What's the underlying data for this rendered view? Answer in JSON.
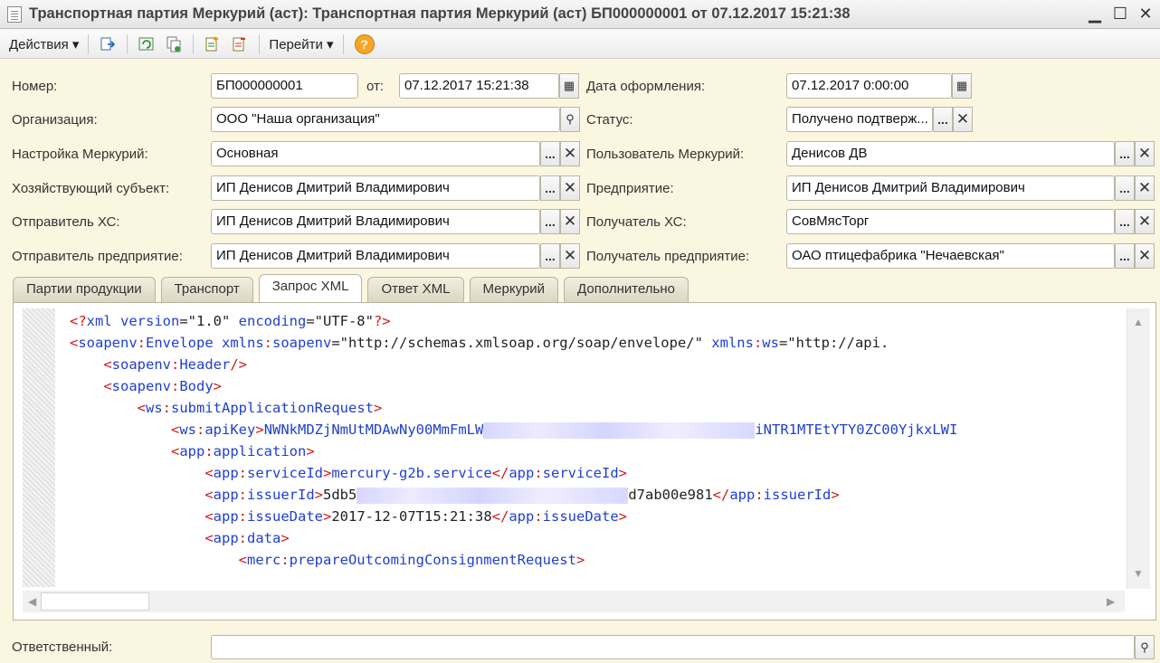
{
  "window": {
    "title": "Транспортная партия Меркурий (аст): Транспортная партия Меркурий (аст) БП000000001 от 07.12.2017 15:21:38",
    "minimize": "▁",
    "maximize": "☐",
    "close": "✕"
  },
  "toolbar": {
    "actions_label": "Действия ▾",
    "goto_label": "Перейти ▾",
    "help_label": "?"
  },
  "form": {
    "number_label": "Номер:",
    "number_value": "БП000000001",
    "from_label": "от:",
    "from_value": "07.12.2017 15:21:38",
    "issue_date_label": "Дата оформления:",
    "issue_date_value": "07.12.2017  0:00:00",
    "org_label": "Организация:",
    "org_value": "ООО \"Наша организация\"",
    "status_label": "Статус:",
    "status_value": "Получено подтверж...",
    "mercury_settings_label": "Настройка Меркурий:",
    "mercury_settings_value": "Основная",
    "mercury_user_label": "Пользователь Меркурий:",
    "mercury_user_value": "Денисов ДВ",
    "business_entity_label": "Хозяйствующий субъект:",
    "business_entity_value": "ИП Денисов Дмитрий Владимирович",
    "enterprise_label": "Предприятие:",
    "enterprise_value": "ИП Денисов Дмитрий Владимирович",
    "sender_hs_label": "Отправитель ХС:",
    "sender_hs_value": "ИП Денисов Дмитрий Владимирович",
    "receiver_hs_label": "Получатель ХС:",
    "receiver_hs_value": "СовМясТорг",
    "sender_ent_label": "Отправитель предприятие:",
    "sender_ent_value": "ИП Денисов Дмитрий Владимирович",
    "receiver_ent_label": "Получатель предприятие:",
    "receiver_ent_value": "ОАО птицефабрика \"Нечаевская\"",
    "responsible_label": "Ответственный:",
    "responsible_value": ""
  },
  "tabs": [
    {
      "label": "Партии продукции"
    },
    {
      "label": "Транспорт"
    },
    {
      "label": "Запрос XML"
    },
    {
      "label": "Ответ XML"
    },
    {
      "label": "Меркурий"
    },
    {
      "label": "Дополнительно"
    }
  ],
  "xml": {
    "l1_a": "<?",
    "l1_b": "xml version",
    "l1_c": "=\"1.0\" ",
    "l1_d": "encoding",
    "l1_e": "=\"UTF-8\"",
    "l1_f": "?>",
    "l2_a": "<",
    "l2_b": "soapenv",
    "l2_c": ":",
    "l2_d": "Envelope",
    "l2_e": " xmlns",
    "l2_f": ":",
    "l2_g": "soapenv",
    "l2_h": "=\"http://schemas.xmlsoap.org/soap/envelope/\" ",
    "l2_i": "xmlns",
    "l2_j": ":",
    "l2_k": "ws",
    "l2_l": "=\"http://api.",
    "l3_a": "<",
    "l3_b": "soapenv",
    "l3_c": ":",
    "l3_d": "Header",
    "l3_e": "/>",
    "l4_a": "<",
    "l4_b": "soapenv",
    "l4_c": ":",
    "l4_d": "Body",
    "l4_e": ">",
    "l5_a": "<",
    "l5_b": "ws",
    "l5_c": ":",
    "l5_d": "submitApplicationRequest",
    "l5_e": ">",
    "l6_a": "<",
    "l6_b": "ws",
    "l6_c": ":",
    "l6_d": "apiKey",
    "l6_e": ">",
    "l6_f": "NWNkMDZjNmUtMDAwNy00MmFmLW",
    "l6_g": "iNTR1MTEtYTY0ZC00YjkxLWI",
    "l7_a": "<",
    "l7_b": "app",
    "l7_c": ":",
    "l7_d": "application",
    "l7_e": ">",
    "l8_a": "<",
    "l8_b": "app",
    "l8_c": ":",
    "l8_d": "serviceId",
    "l8_e": ">",
    "l8_f": "mercury-g2b.service",
    "l8_g": "</",
    "l8_h": "app",
    "l8_i": ":",
    "l8_j": "serviceId",
    "l8_k": ">",
    "l9_a": "<",
    "l9_b": "app",
    "l9_c": ":",
    "l9_d": "issuerId",
    "l9_e": ">",
    "l9_f": "5db5",
    "l9_g": "d7ab00e981",
    "l9_h": "</",
    "l9_i": "app",
    "l9_j": ":",
    "l9_k": "issuerId",
    "l9_l": ">",
    "l10_a": "<",
    "l10_b": "app",
    "l10_c": ":",
    "l10_d": "issueDate",
    "l10_e": ">",
    "l10_f": "2017-12-07T15:21:38",
    "l10_g": "</",
    "l10_h": "app",
    "l10_i": ":",
    "l10_j": "issueDate",
    "l10_k": ">",
    "l11_a": "<",
    "l11_b": "app",
    "l11_c": ":",
    "l11_d": "data",
    "l11_e": ">",
    "l12_a": "<",
    "l12_b": "merc",
    "l12_c": ":",
    "l12_d": "prepareOutcomingConsignmentRequest",
    "l12_e": ">"
  },
  "buttons": {
    "ellipsis": "...",
    "clear": "✕",
    "calendar": "▦",
    "search": "⚲"
  }
}
